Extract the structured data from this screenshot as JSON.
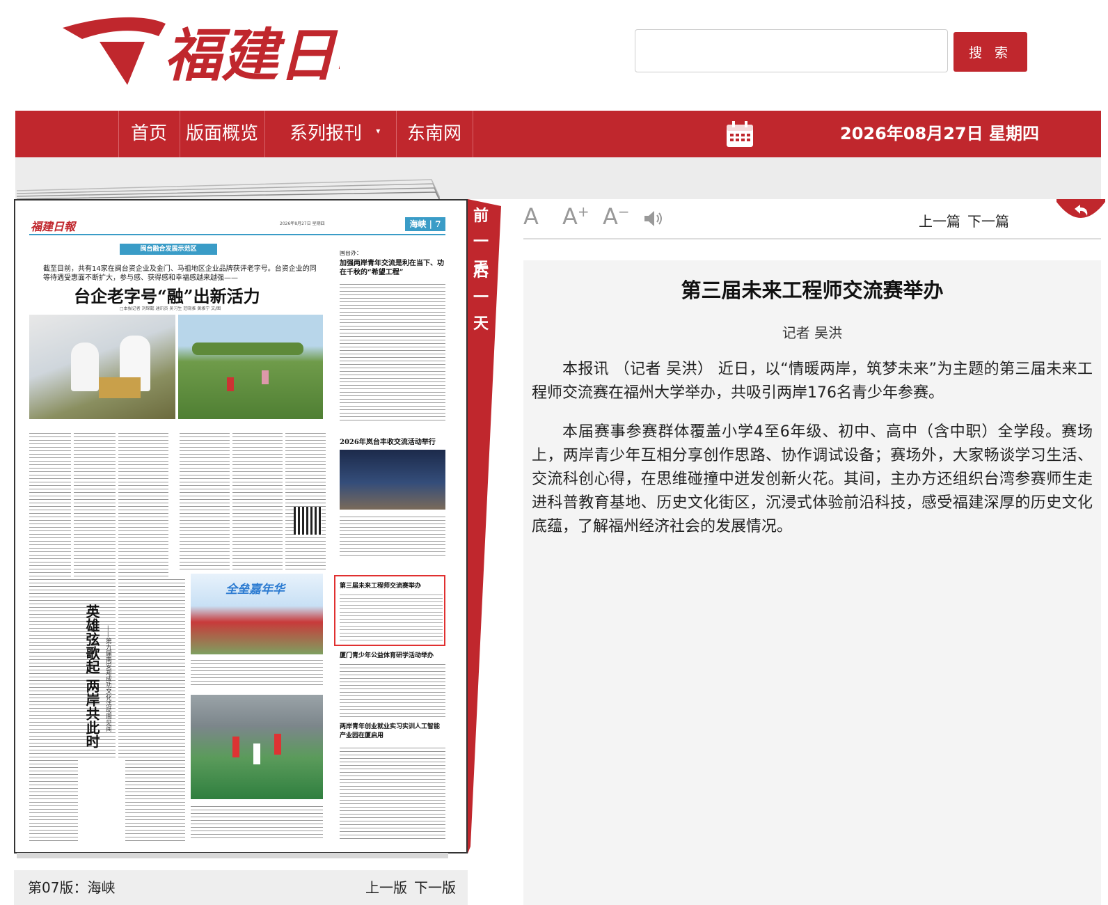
{
  "header": {
    "logo_text": "福建日報",
    "search": {
      "placeholder": "",
      "value": "",
      "button_label": "搜 索"
    }
  },
  "nav": {
    "items": [
      "首页",
      "版面概览",
      "系列报刊",
      "东南网"
    ],
    "date": "2026年08月27日 星期四"
  },
  "side_tab": {
    "prev_day": "前一天",
    "next_day": "后一天"
  },
  "newspaper": {
    "masthead": "福建日報",
    "section_tag": "海峡 | 7",
    "header_info": "2026年8月27日 星期四",
    "banner": "闽台融合发展示范区",
    "lead_intro": "截至目前，共有14家在闽台资企业及金门、马祖地区企业品牌获评老字号。台资企业的同等待遇受惠面不断扩大，参与感、获得感和幸福感越来越强——",
    "main_headline": "台企老字号“融”出新活力",
    "byline": "□本报记者 刘琛懿 通讯员 吴习生 范晓雅 黄雅宁 文/图",
    "right_top_label": "国台办：",
    "right_top_head": "加强两岸青年交流是利在当下、功在千秋的“希望工程”",
    "mid_right_head": "2026年岚台丰收交流活动举行",
    "highlight_head": "第三届未来工程师交流赛举办",
    "bottom_right_head1": "厦门青少年公益体育研学活动举办",
    "bottom_right_head2": "两岸青年创业就业实习实训人工智能产业园在厦启用",
    "vertical_head": "英雄弦歌起 两岸共此时",
    "vertical_sub": "——第九届南安郑成功文化活动周见闻",
    "photo_banner": "全垒嘉年华"
  },
  "page_footer": {
    "label": "第07版：海峡",
    "prev": "上一版",
    "next": "下一版"
  },
  "toolbar": {
    "font_large": "A",
    "font_up": "A",
    "font_down": "A",
    "prev_article": "上一篇",
    "next_article": "下一篇"
  },
  "article": {
    "title": "第三届未来工程师交流赛举办",
    "author": "记者 吴洪",
    "paragraphs": [
      "本报讯 （记者 吴洪） 近日，以“情暖两岸，筑梦未来”为主题的第三届未来工程师交流赛在福州大学举办，共吸引两岸176名青少年参赛。",
      "本届赛事参赛群体覆盖小学4至6年级、初中、高中（含中职）全学段。赛场上，两岸青少年互相分享创作思路、协作调试设备；赛场外，大家畅谈学习生活、交流科创心得，在思维碰撞中迸发创新火花。其间，主办方还组织台湾参赛师生走进科普教育基地、历史文化街区，沉浸式体验前沿科技，感受福建深厚的历史文化底蕴，了解福州经济社会的发展情况。"
    ]
  },
  "colors": {
    "brand_red": "#c0272d",
    "panel_grey": "#f4f4f4"
  }
}
